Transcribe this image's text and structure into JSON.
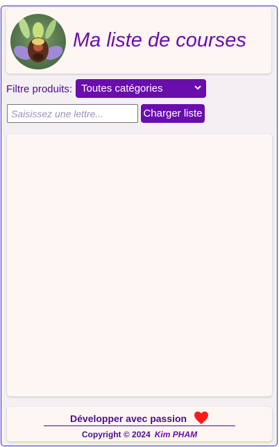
{
  "header": {
    "title": "Ma liste de courses",
    "avatar_icon": "orchid-flower-icon"
  },
  "filter": {
    "label": "Filtre produits:",
    "selected": "Toutes catégories"
  },
  "search": {
    "placeholder": "Saisissez une lettre...",
    "value": ""
  },
  "load_button": {
    "label": "Charger liste"
  },
  "footer": {
    "tagline": "Développer avec passion",
    "copyright": "Copyright © 2024",
    "author": "Kim PHAM"
  },
  "colors": {
    "accent": "#6a0dad",
    "text_purple": "#4b0f8a",
    "card_bg": "#fef6f2",
    "heart": "#ff1a1a"
  }
}
